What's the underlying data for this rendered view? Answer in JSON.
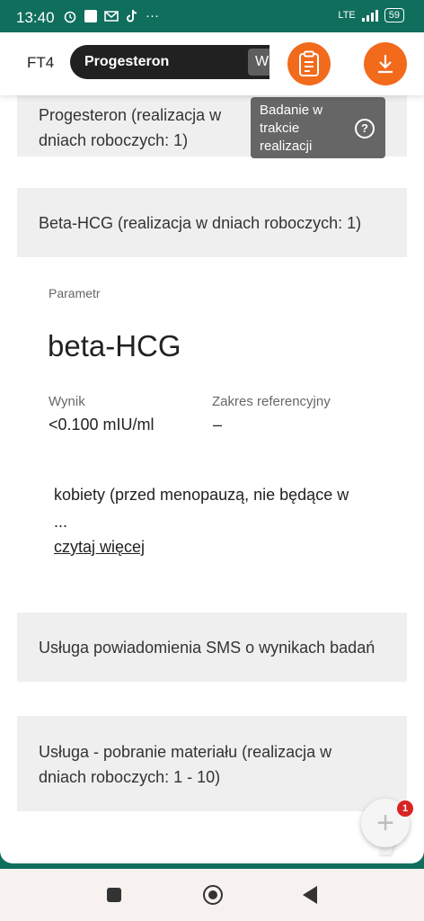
{
  "status_bar": {
    "time": "13:40",
    "dots": "···",
    "network": "LTE",
    "battery": "59"
  },
  "header": {
    "code": "FT4",
    "test_name": "Progesteron",
    "test_status": "W realizacji",
    "accent_color": "#f26a1b"
  },
  "cards": {
    "progesteron": {
      "title": "Progesteron (realizacja w dniach roboczych: 1)",
      "badge": "Badanie w trakcie realizacji",
      "help_glyph": "?"
    },
    "beta_hcg": {
      "title": "Beta-HCG (realizacja w dniach roboczych: 1)"
    },
    "sms": {
      "title": "Usługa powiadomienia SMS o wynikach badań"
    },
    "pobranie": {
      "title": "Usługa - pobranie materiału (realizacja w dniach roboczych: 1 - 10)"
    }
  },
  "parameter": {
    "label": "Parametr",
    "name": "beta-HCG",
    "result_label": "Wynik",
    "result_value": "<0.100 mIU/ml",
    "reference_label": "Zakres referencyjny",
    "reference_value": "–",
    "note": "kobiety (przed menopauzą, nie będące w",
    "ellipsis": "...",
    "read_more": "czytaj więcej"
  },
  "fab": {
    "glyph": "+",
    "badge_count": "1"
  },
  "icons": [
    "alarm-icon",
    "app-square-icon",
    "mail-icon",
    "tiktok-icon",
    "clipboard-icon",
    "download-icon",
    "plus-icon",
    "help-icon"
  ]
}
